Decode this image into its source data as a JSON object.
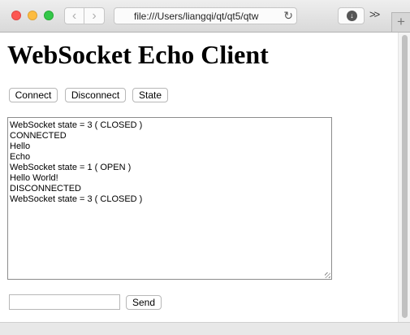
{
  "browser": {
    "url": "file:///Users/liangqi/qt/qt5/qtw",
    "back_icon": "‹",
    "forward_icon": "›",
    "reload_icon": "↻",
    "download_icon": "↓",
    "overflow_icon": ">>",
    "new_tab_icon": "+",
    "colors": {
      "close": "#fc5753",
      "minimize": "#fdbc40",
      "zoom": "#33c748"
    }
  },
  "page": {
    "title": "WebSocket Echo Client",
    "buttons": {
      "connect": "Connect",
      "disconnect": "Disconnect",
      "state": "State",
      "send": "Send"
    },
    "log_lines": [
      "WebSocket state = 3 ( CLOSED )",
      "CONNECTED",
      "Hello",
      "Echo",
      "WebSocket state = 1 ( OPEN )",
      "Hello World!",
      "DISCONNECTED",
      "WebSocket state = 3 ( CLOSED )"
    ],
    "message_input": {
      "value": ""
    }
  }
}
